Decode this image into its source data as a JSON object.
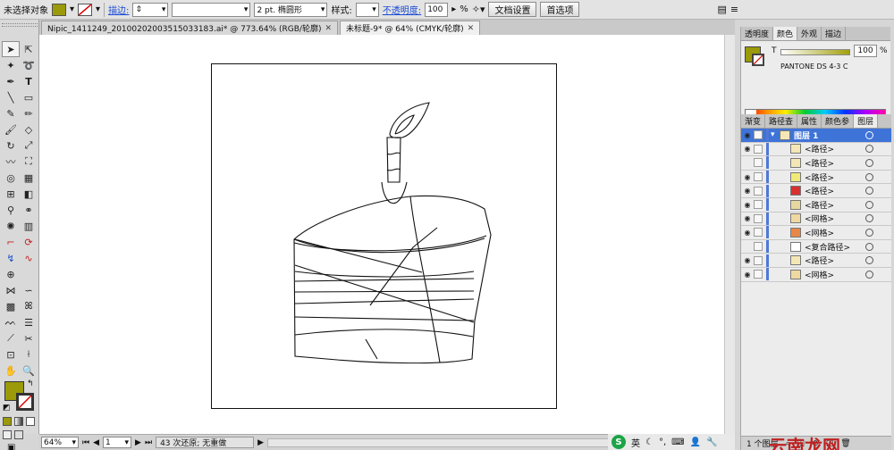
{
  "control_bar": {
    "selection_status": "未选择对象",
    "stroke_label": "描边:",
    "stroke_profile": "2 pt. 椭圆形",
    "style_label": "样式:",
    "opacity_label": "不透明度:",
    "opacity_value": "100",
    "opacity_unit": "%",
    "doc_setup_button": "文档设置",
    "preferences_button": "首选项",
    "colors": {
      "fill": "#9a9a0a"
    }
  },
  "tabs": [
    {
      "label": "Nipic_1411249_20100202003515033183.ai* @ 773.64% (RGB/轮廓)",
      "close": "✕"
    },
    {
      "label": "未标题-9* @ 64% (CMYK/轮廓)",
      "close": "✕"
    }
  ],
  "status_bar": {
    "zoom": "64%",
    "page": "1",
    "undo_message": "43 次还原; 无重做",
    "ime_text": "英"
  },
  "color_panel": {
    "tabs": [
      "透明度",
      "颜色",
      "外观",
      "描边"
    ],
    "tint_label": "T",
    "tint_value": "100",
    "tint_unit": "%",
    "swatch_name": "PANTONE DS 4-3 C"
  },
  "layers_panel": {
    "tabs": [
      "渐变",
      "路径查",
      "属性",
      "颜色参",
      "图层"
    ],
    "layer_name": "图层 1",
    "items": [
      {
        "name": "<路径>",
        "visible": true
      },
      {
        "name": "<路径>",
        "visible": false
      },
      {
        "name": "<路径>",
        "visible": true
      },
      {
        "name": "<路径>",
        "visible": true
      },
      {
        "name": "<路径>",
        "visible": true
      },
      {
        "name": "<网格>",
        "visible": true
      },
      {
        "name": "<网格>",
        "visible": true
      },
      {
        "name": "<复合路径>",
        "visible": false
      },
      {
        "name": "<路径>",
        "visible": true
      },
      {
        "name": "<网格>",
        "visible": true
      }
    ],
    "footer": "1 个图层"
  },
  "watermark": "云南龙网"
}
